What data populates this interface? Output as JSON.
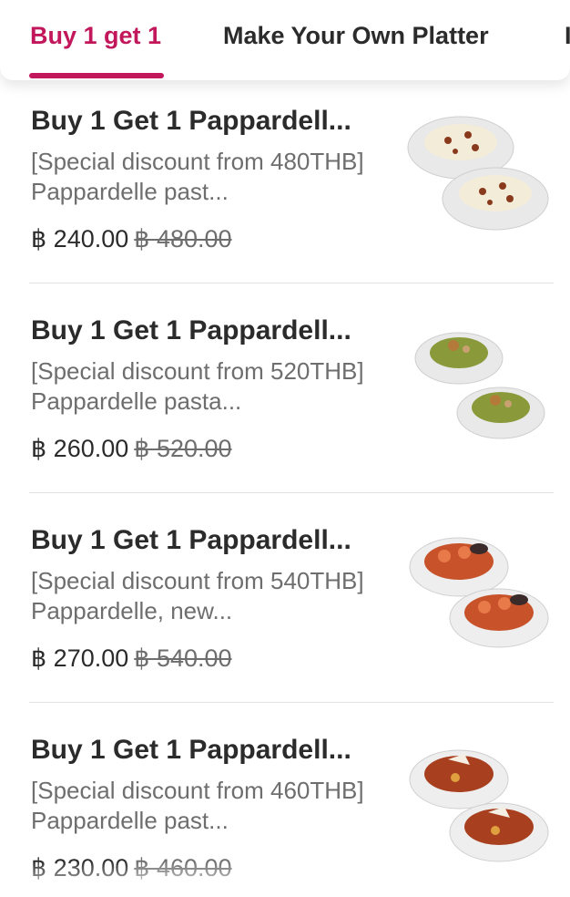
{
  "tabs": [
    {
      "label": "Buy 1 get 1",
      "active": true
    },
    {
      "label": "Make Your Own Platter",
      "active": false
    },
    {
      "label": "I",
      "active": false
    }
  ],
  "colors": {
    "accent": "#c2185b",
    "text": "#2b2b2b",
    "muted": "#6e6e6e",
    "divider": "#e2e2e2"
  },
  "items": [
    {
      "title": "Buy 1 Get 1 Pappardell...",
      "description": "[Special discount from 480THB] Pappardelle past...",
      "price": "฿ 240.00",
      "original_price": "฿ 480.00",
      "image": "two-bowls-cream-pasta-icon"
    },
    {
      "title": "Buy 1 Get 1 Pappardell...",
      "description": "[Special discount from 520THB] Pappardelle pasta...",
      "price": "฿ 260.00",
      "original_price": "฿ 520.00",
      "image": "two-bowls-pesto-pasta-icon"
    },
    {
      "title": "Buy 1 Get 1 Pappardell...",
      "description": "[Special discount from 540THB] Pappardelle, new...",
      "price": "฿ 270.00",
      "original_price": "฿ 540.00",
      "image": "two-bowls-seafood-pasta-icon"
    },
    {
      "title": "Buy 1 Get 1 Pappardell...",
      "description": "[Special discount from 460THB] Pappardelle past...",
      "price": "฿ 230.00",
      "original_price": "฿ 460.00",
      "image": "two-bowls-bolognese-pasta-icon"
    }
  ]
}
